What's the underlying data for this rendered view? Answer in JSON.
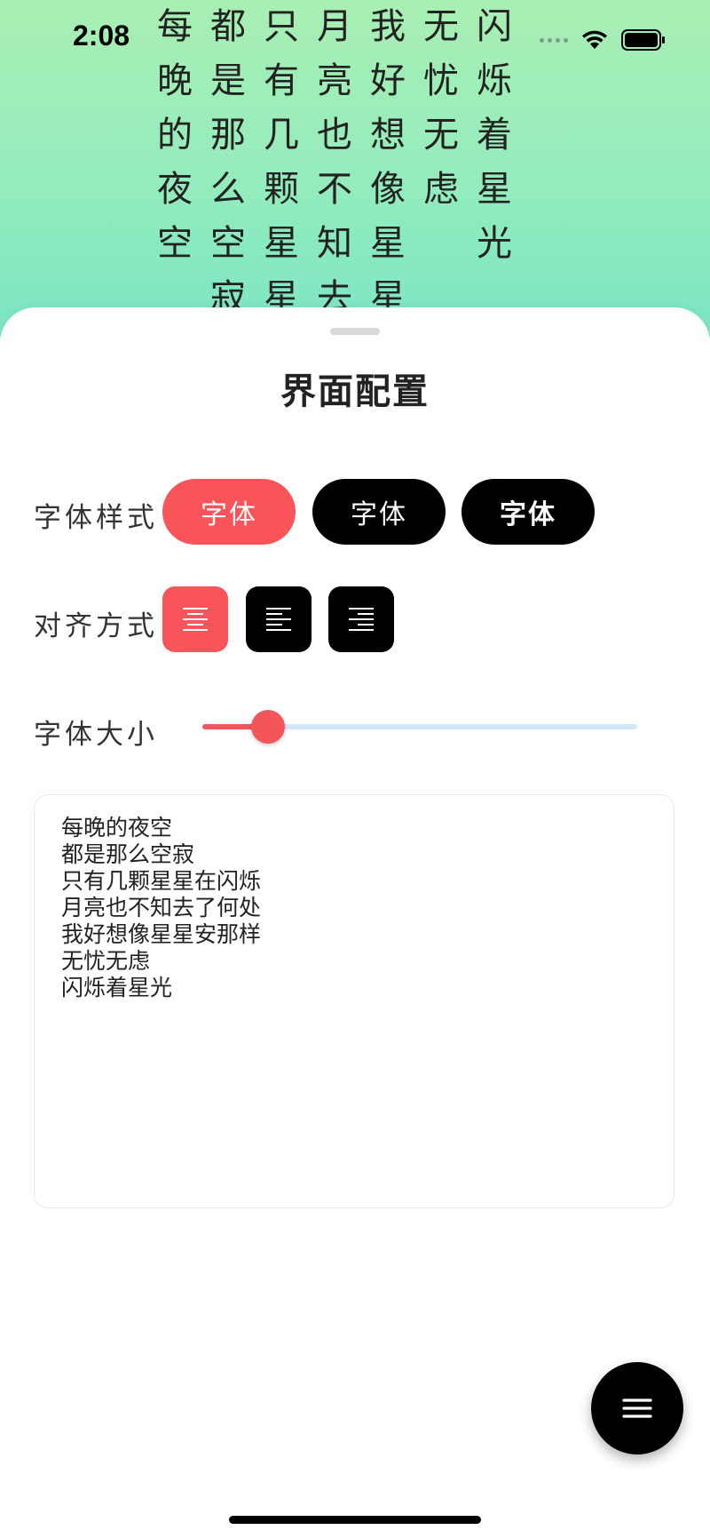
{
  "status_bar": {
    "time": "2:08"
  },
  "poem_columns": [
    {
      "text": "每晚的夜空"
    },
    {
      "text": "都是那么空寂"
    },
    {
      "text": "只有几颗星星"
    },
    {
      "text": "月亮也不知去"
    },
    {
      "text": "我好想像星星"
    },
    {
      "text": "无忧无虑"
    },
    {
      "text": "闪烁着星光"
    }
  ],
  "sheet": {
    "title": "界面配置",
    "font_style": {
      "label": "字体样式",
      "options": [
        "字体",
        "字体",
        "字体"
      ],
      "selected_index": 0
    },
    "alignment": {
      "label": "对齐方式",
      "options_icons": [
        "align-center-icon",
        "align-left-icon",
        "align-right-icon"
      ],
      "selected_index": 0
    },
    "font_size": {
      "label": "字体大小",
      "value_fraction": 0.15
    },
    "text_input": {
      "value": "每晚的夜空\n都是那么空寂\n只有几颗星星在闪烁\n月亮也不知去了何处\n我好想像星星安那样\n无忧无虑\n闪烁着星光"
    }
  },
  "colors": {
    "accent": "#f9545a",
    "button_dark": "#000000",
    "slider_track": "#d1e6f8",
    "bg_top": "#a9efb3",
    "bg_bottom": "#7be6c3"
  },
  "fab": {
    "icon": "menu-icon"
  }
}
